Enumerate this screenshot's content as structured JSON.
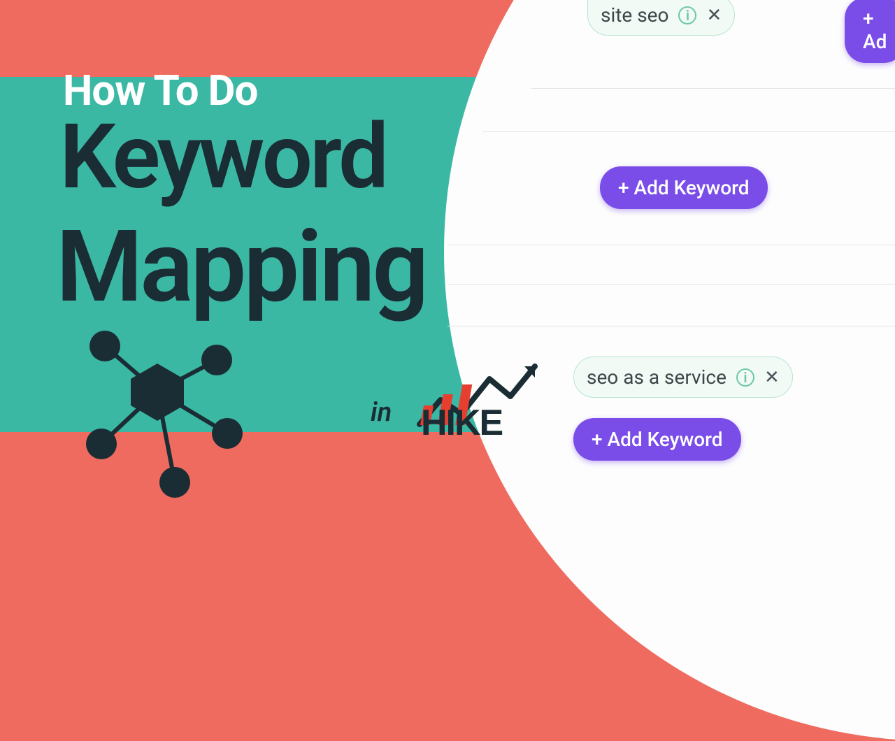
{
  "title": {
    "line1": "How To Do",
    "line2": "Keyword",
    "line3": "Mapping",
    "inword": "in",
    "brand": "HIKE"
  },
  "panel": {
    "chip_partial": "site seo",
    "btn_partial": "+ Ad",
    "add_label_1": "+ Add Keyword",
    "chip_full": "seo as a service",
    "add_label_2": "+ Add Keyword"
  }
}
